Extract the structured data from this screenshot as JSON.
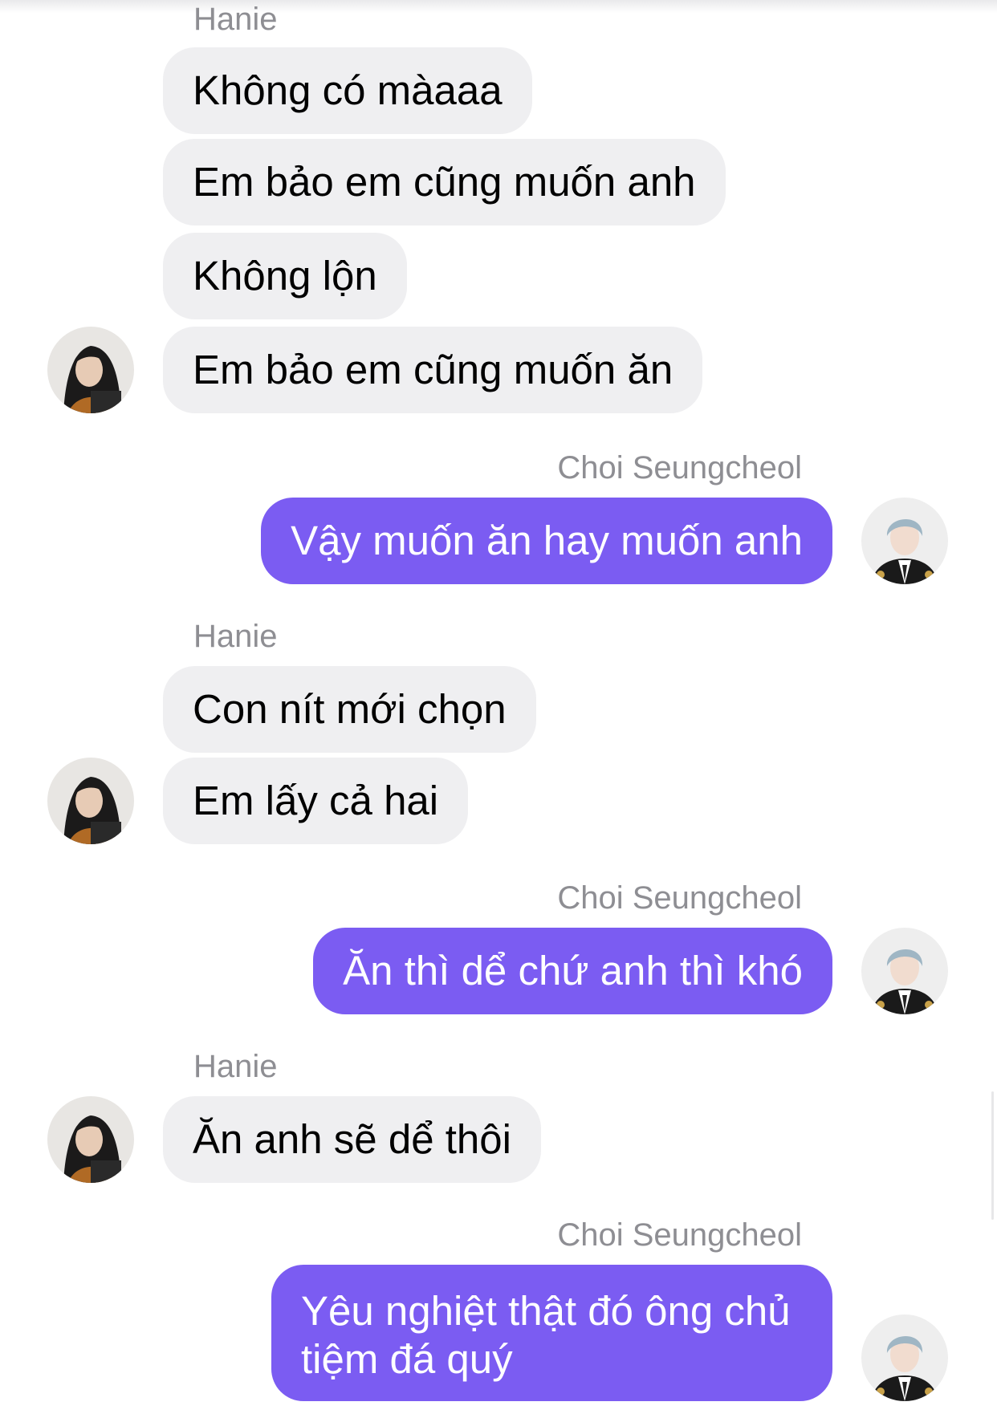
{
  "conversation": {
    "hanie_name": "Hanie",
    "choi_name": "Choi Seungcheol",
    "msg1": "Không có màaaa",
    "msg2": "Em bảo em cũng muốn anh",
    "msg3": "Không lộn",
    "msg4": "Em bảo em cũng muốn ăn",
    "msg5": "Vậy muốn ăn hay muốn anh",
    "msg6": "Con nít mới chọn",
    "msg7": "Em lấy cả hai",
    "msg8": "Ăn thì dể chứ anh thì khó",
    "msg9": "Ăn anh sẽ dể thôi",
    "msg10": "Yêu nghiệt thật đó ông chủ tiệm đá quý"
  },
  "colors": {
    "incoming_bubble": "#efeff1",
    "outgoing_bubble": "#7b5cf2",
    "sender_name": "#8e8e93"
  },
  "icons": {
    "hanie_avatar": "user-avatar-hanie",
    "choi_avatar": "user-avatar-choi"
  }
}
